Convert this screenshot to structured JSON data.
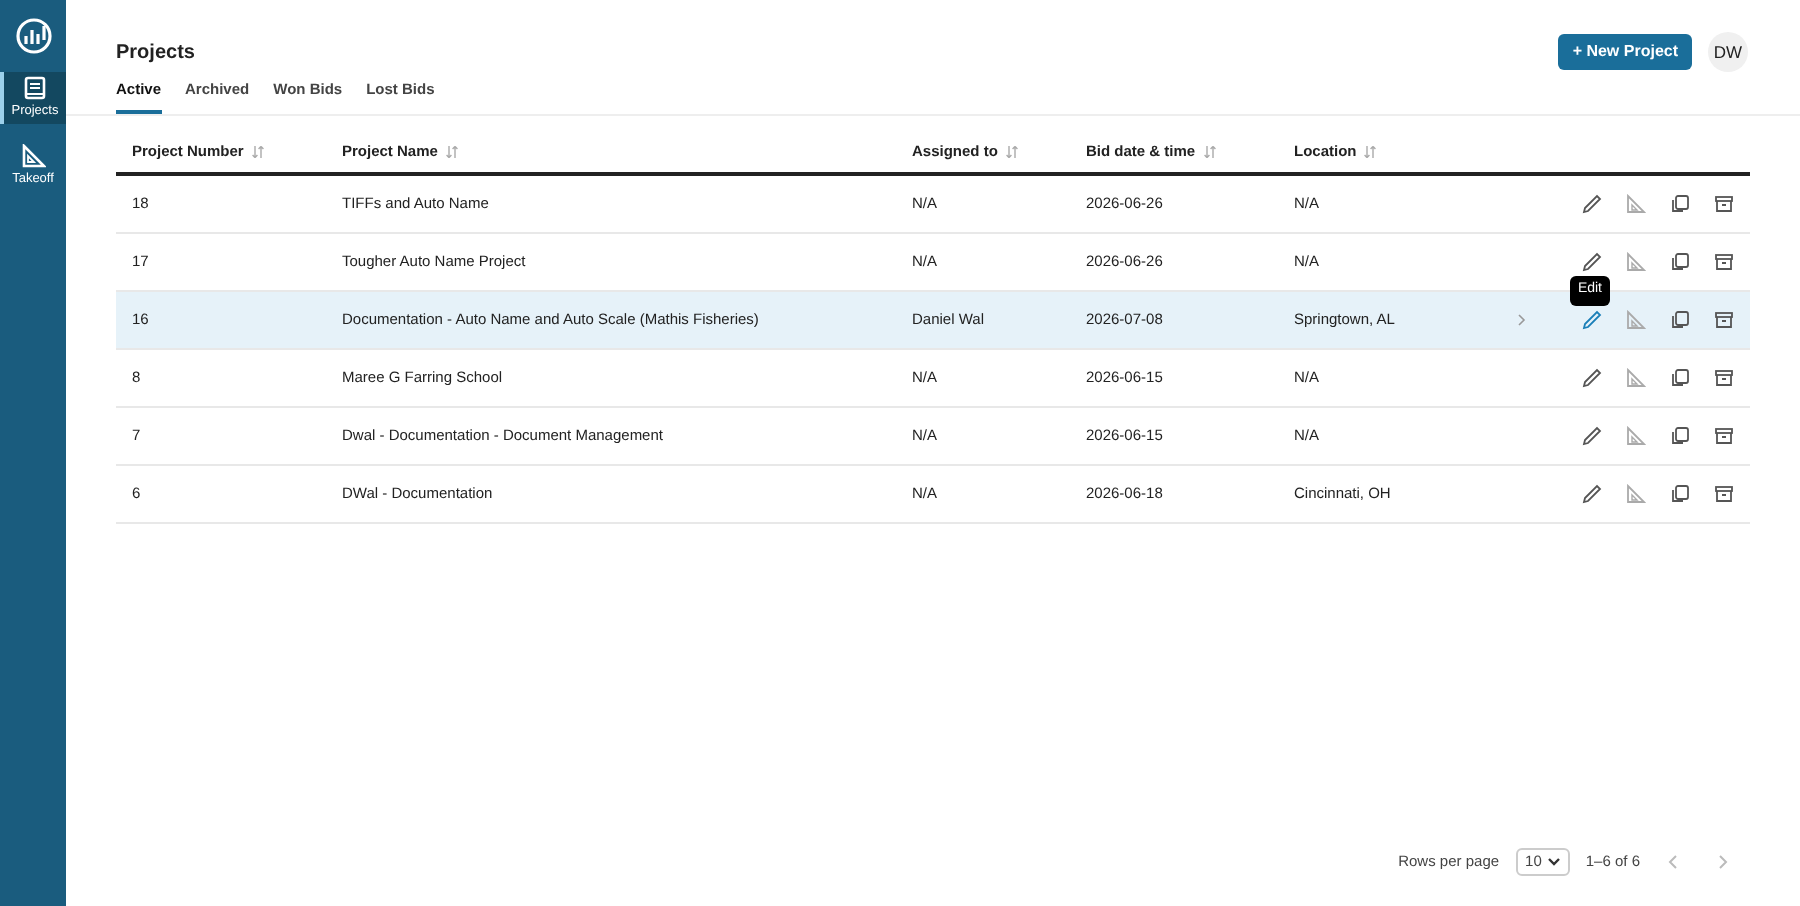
{
  "sidebar": {
    "items": [
      {
        "label": "Projects",
        "selected": true
      },
      {
        "label": "Takeoff",
        "selected": false
      }
    ]
  },
  "header": {
    "title": "Projects",
    "new_button": "+ New Project",
    "avatar": "DW"
  },
  "tabs": [
    {
      "label": "Active",
      "selected": true
    },
    {
      "label": "Archived",
      "selected": false
    },
    {
      "label": "Won Bids",
      "selected": false
    },
    {
      "label": "Lost Bids",
      "selected": false
    }
  ],
  "table": {
    "columns": [
      "Project Number",
      "Project Name",
      "Assigned to",
      "Bid date & time",
      "Location"
    ],
    "rows": [
      {
        "cells": [
          "18",
          "TIFFs and Auto Name",
          "N/A",
          "2026-06-26",
          "N/A"
        ],
        "hovered": false
      },
      {
        "cells": [
          "17",
          "Tougher Auto Name Project",
          "N/A",
          "2026-06-26",
          "N/A"
        ],
        "hovered": false
      },
      {
        "cells": [
          "16",
          "Documentation - Auto Name and Auto Scale (Mathis Fisheries)",
          "Daniel Wal",
          "2026-07-08",
          "Springtown, AL"
        ],
        "hovered": true,
        "tooltip": "Edit"
      },
      {
        "cells": [
          "8",
          "Maree G Farring School",
          "N/A",
          "2026-06-15",
          "N/A"
        ],
        "hovered": false
      },
      {
        "cells": [
          "7",
          "Dwal - Documentation - Document Management",
          "N/A",
          "2026-06-15",
          "N/A"
        ],
        "hovered": false
      },
      {
        "cells": [
          "6",
          "DWal - Documentation",
          "N/A",
          "2026-06-18",
          "Cincinnati, OH"
        ],
        "hovered": false
      }
    ]
  },
  "pagination": {
    "rows_per_page_label": "Rows per page",
    "rows_per_page": "10",
    "range": "1–6 of 6"
  }
}
